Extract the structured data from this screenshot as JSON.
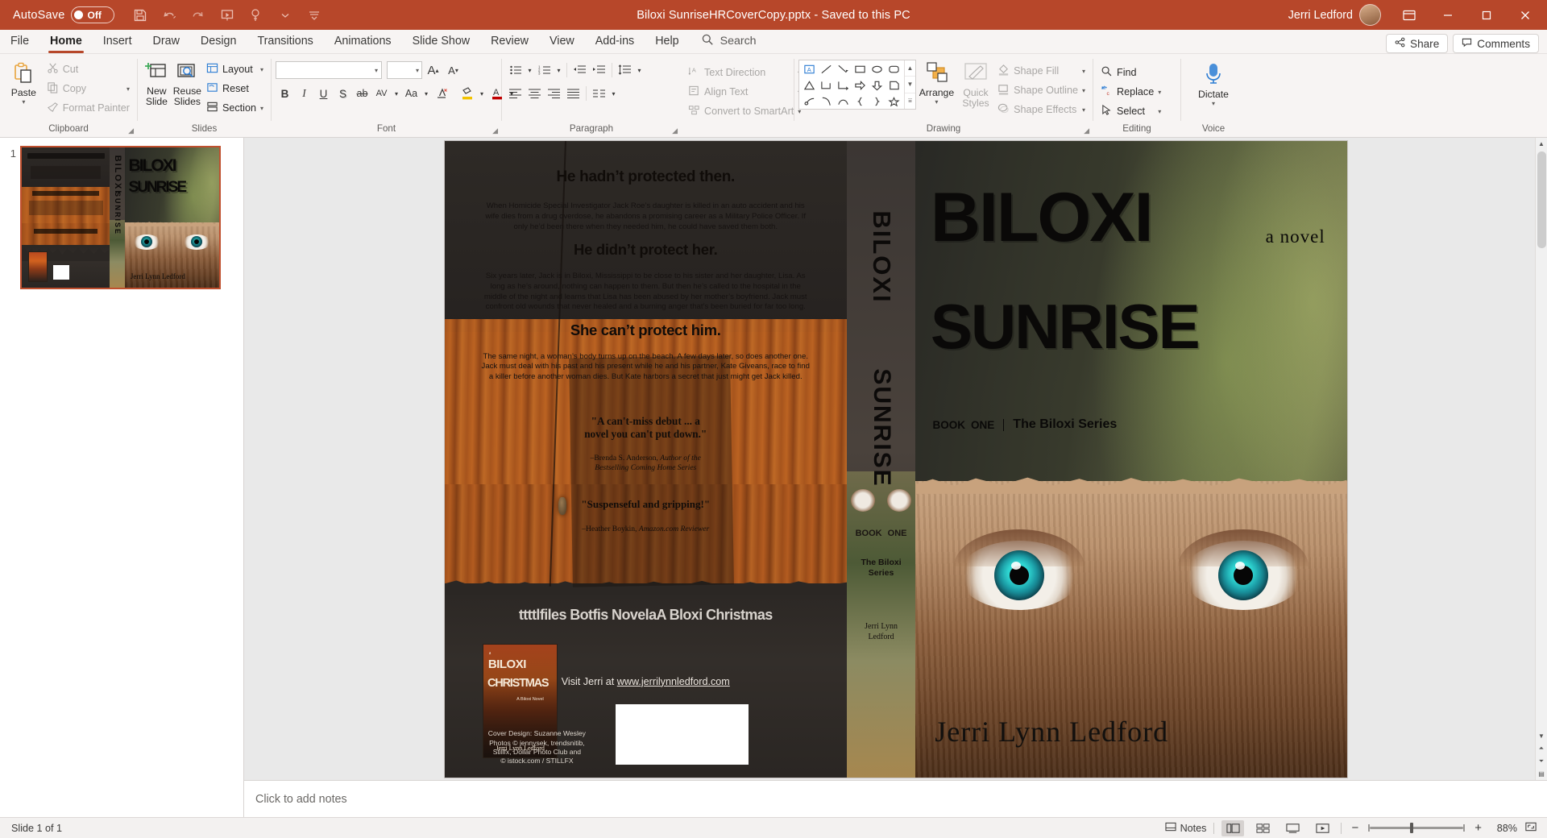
{
  "titlebar": {
    "autosave_label": "AutoSave",
    "autosave_state": "Off",
    "document_title": "Biloxi SunriseHRCoverCopy.pptx  -  Saved to this PC",
    "user_name": "Jerri Ledford",
    "qat": [
      {
        "name": "save-icon",
        "tooltip": "Save"
      },
      {
        "name": "undo-icon",
        "tooltip": "Undo"
      },
      {
        "name": "redo-icon",
        "tooltip": "Redo"
      },
      {
        "name": "start-presentation-icon",
        "tooltip": "Start From Beginning"
      },
      {
        "name": "touch-mode-icon",
        "tooltip": "Touch/Mouse Mode"
      },
      {
        "name": "customize-qat-icon",
        "tooltip": "Customize Quick Access Toolbar"
      }
    ],
    "window_controls": {
      "minimize": "—",
      "maximize": "❐",
      "restore": "❐",
      "close": "✕"
    }
  },
  "tabs": [
    {
      "label": "File",
      "active": false
    },
    {
      "label": "Home",
      "active": true
    },
    {
      "label": "Insert",
      "active": false
    },
    {
      "label": "Draw",
      "active": false
    },
    {
      "label": "Design",
      "active": false
    },
    {
      "label": "Transitions",
      "active": false
    },
    {
      "label": "Animations",
      "active": false
    },
    {
      "label": "Slide Show",
      "active": false
    },
    {
      "label": "Review",
      "active": false
    },
    {
      "label": "View",
      "active": false
    },
    {
      "label": "Add-ins",
      "active": false
    },
    {
      "label": "Help",
      "active": false
    }
  ],
  "search": {
    "placeholder": "Search",
    "label": "Search"
  },
  "header_right": {
    "share_label": "Share",
    "comments_label": "Comments"
  },
  "ribbon": {
    "groups": [
      {
        "name": "Clipboard",
        "label": "Clipboard"
      },
      {
        "name": "Slides",
        "label": "Slides"
      },
      {
        "name": "Font",
        "label": "Font"
      },
      {
        "name": "Paragraph",
        "label": "Paragraph"
      },
      {
        "name": "Drawing",
        "label": "Drawing"
      },
      {
        "name": "Editing",
        "label": "Editing"
      },
      {
        "name": "Voice",
        "label": "Voice"
      }
    ],
    "clipboard": {
      "paste_label": "Paste",
      "cut_label": "Cut",
      "copy_label": "Copy",
      "format_painter_label": "Format Painter"
    },
    "slides": {
      "new_slide_label": "New\nSlide",
      "new_slide_line1": "New",
      "new_slide_line2": "Slide",
      "reuse_line1": "Reuse",
      "reuse_line2": "Slides",
      "layout_label": "Layout",
      "reset_label": "Reset",
      "section_label": "Section"
    },
    "font": {
      "font_name": "",
      "font_size": "",
      "grow_font": "A",
      "shrink_font": "A",
      "clear_formatting": "A",
      "bold": "B",
      "italic": "I",
      "underline": "U",
      "shadow": "S",
      "strikethrough": "ab",
      "char_spacing": "AV",
      "change_case": "Aa",
      "text_highlight": "A",
      "font_color": "A"
    },
    "paragraph": {
      "text_direction_label": "Text Direction",
      "align_text_label": "Align Text",
      "convert_smartart_label": "Convert to SmartArt"
    },
    "drawing": {
      "arrange_label": "Arrange",
      "quick_styles_line1": "Quick",
      "quick_styles_line2": "Styles",
      "shape_fill_label": "Shape Fill",
      "shape_outline_label": "Shape Outline",
      "shape_effects_label": "Shape Effects"
    },
    "editing": {
      "find_label": "Find",
      "replace_label": "Replace",
      "select_label": "Select"
    },
    "voice": {
      "dictate_label": "Dictate"
    }
  },
  "slide_panel": {
    "slide_number": "1"
  },
  "notes": {
    "placeholder": "Click to add notes"
  },
  "status": {
    "slide_count_text": "Slide 1 of 1",
    "notes_button": "Notes",
    "views": [
      {
        "name": "normal-view",
        "active": true
      },
      {
        "name": "slide-sorter-view",
        "active": false
      },
      {
        "name": "reading-view",
        "active": false
      },
      {
        "name": "slide-show-view",
        "active": false
      }
    ],
    "zoom_out": "−",
    "zoom_in": "+",
    "zoom_level": "88%",
    "fit_slide_label": "Fit slide to current window"
  },
  "cover": {
    "back": {
      "head1": "He hadn’t protected  then.",
      "body1": "When Homicide Special Investigator Jack Roe’s daughter is killed in an auto  accident and his wife dies from a drug overdose, he abandons a promising career as  a Military Police Officer. If only he’d been there when they needed him, he could  have saved them both.",
      "head2": "He didn’t protect  her.",
      "body2": "Six years later, Jack is in Biloxi, Mississippi to be close to his sister  and her daughter, Lisa. As long as he’s around, nothing can happen to them. But then he’s called to the hospital in the middle of the night and learns that Lisa has been abused by her mother’s boyfriend. Jack must confront old wounds that never healed  and a burning anger that’s been buried for far too long.",
      "head3": "She    can’t    protect    him.",
      "body3": "The same night, a woman’s body turns up on the beach. A few days later, so does another one. Jack must deal with his past and his present while he and his partner, Kate Giveans, race to find a killer before another woman dies. But Kate harbors a secret that just might get Jack killed.",
      "quote1_line1": "\"A can't-miss debut ... a",
      "quote1_line2": "novel you can't put down.\"",
      "quote1_attr_name": "–Brenda S. Anderson,",
      "quote1_attr_italic": "Author of the",
      "quote1_attr_italic2": "Bestselling Coming Home Series",
      "quote2": "\"Suspenseful and gripping!\"",
      "quote2_attr_name": "–Heather Boykin,",
      "quote2_attr_italic": "Amazon.com Reviewer",
      "also_available": "ttttlfiles Botfis NovelaA Bloxi Christmas",
      "visit_prefix": "Visit Jerri at ",
      "visit_link": "www.jerrilynnledford.com",
      "credits_line1": "Cover Design: Suzanne Wesley",
      "credits_line2": "Photos © jennysek, trendsnitib,",
      "credits_line3": "Stillfx, Dollar Photo Club and",
      "credits_line4": "© istock.com / STILLFX",
      "mini_cover_title1": "BILOXI",
      "mini_cover_title2": "CHRISTMAS",
      "mini_cover_sub": "A Biloxi Novel",
      "mini_cover_author": "Jerri Lynn Ledford"
    },
    "spine": {
      "title_line1": "BILOXI",
      "title_line2": "SUNRISE",
      "book_label": "BOOK",
      "book_number": "ONE",
      "series": "The Biloxi",
      "series2": "Series",
      "author_line1": "Jerri Lynn",
      "author_line2": "Ledford"
    },
    "front": {
      "title_line1": "BILOXI",
      "title_line2": "SUNRISE",
      "a_novel": "a  novel",
      "book_label": "BOOK",
      "book_number": "ONE",
      "series_label": "The Biloxi Series",
      "author": "Jerri Lynn Ledford"
    }
  },
  "colors": {
    "accent": "#b7472a",
    "ribbon_bg": "#f7f4f3",
    "tab_active_underline": "#b7472a",
    "thumb_selected_border": "#c0502f"
  }
}
